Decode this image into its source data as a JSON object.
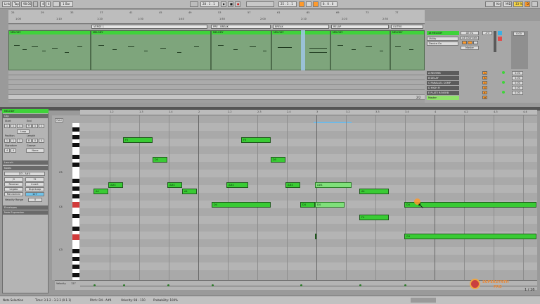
{
  "transport": {
    "link": "Link",
    "tap": "Tap",
    "tempo": "98.00",
    "sig_num": "4",
    "sig_den": "4",
    "quant": "1 Bar",
    "position": "28 . 1 . 1",
    "loop_start": "25 . 1 . 1",
    "loop_len": "8 . 0 . 0",
    "key": "Key",
    "midi": "MIDI",
    "cpu": "33 %",
    "d": "D"
  },
  "arrangement": {
    "bar_ticks": [
      "25",
      "29",
      "33",
      "37",
      "41",
      "45",
      "49",
      "53",
      "57",
      "61",
      "65",
      "69",
      "73",
      "77"
    ],
    "time_ticks": [
      "1:00",
      "1:10",
      "1:20",
      "1:30",
      "1:40",
      "1:50",
      "2:00",
      "2:10",
      "2:20",
      "2:30"
    ],
    "locators": [
      "VERSE 1",
      "PRE - BREAK",
      "BREAK",
      "RELAP",
      "OUTRO"
    ],
    "clips": [
      "MELODY",
      "MELODY",
      "MELODY",
      "MELODY",
      "MELODY",
      "MELODY"
    ],
    "counter": "2/2"
  },
  "mixer": {
    "main_track": "18 MELODY",
    "input_type": "All Ins",
    "input_channel": "All Channels",
    "monitor_label": "Utility",
    "routing": "Device On",
    "output": "Master",
    "volume": "-inf",
    "returns": [
      "A REVERB",
      "B DELAY",
      "C PARALLEL COMP",
      "D HIGH FI",
      "E PLATE REVERB",
      "Master"
    ],
    "return_letters": [
      "A",
      "B",
      "C",
      "D",
      "E",
      "M"
    ],
    "return_vals": [
      "0.00",
      "0.00",
      "0.00",
      "0.00",
      "0.00",
      "0.00"
    ]
  },
  "clip_view": {
    "title": "MELODY",
    "clip_header": "Clip",
    "start_label": "Start",
    "end_label": "End",
    "start_val": [
      "1",
      "1",
      "1"
    ],
    "end_val": [
      "9",
      "1",
      "1"
    ],
    "loop_label": "Loop",
    "position_label": "Position",
    "length_label": "Length",
    "position_val": [
      "1",
      "1",
      "1"
    ],
    "length_val": [
      "8",
      "0",
      "0"
    ],
    "signature_label": "Signature",
    "groove_label": "Groove",
    "sig_val": [
      "4",
      "4"
    ],
    "groove_val": "None",
    "launch_label": "Launch",
    "notes_label": "Notes",
    "note_range": "D3 - A#4",
    "btn_half": "/2",
    "btn_double": "*2",
    "btn_reverse": "Reverse",
    "btn_invert": "Invert",
    "btn_legato": "Legato",
    "btn_dupl": "Dupl.Loop",
    "randomize_label": "Randomize",
    "randomize_val": "127",
    "velocity_range_label": "Velocity Range",
    "velocity_range_val": "0",
    "envelopes_label": "Envelopes",
    "note_expression_label": "Note Expression"
  },
  "piano_roll": {
    "fold": "Fold",
    "ruler_ticks": [
      "1.2",
      "1.3",
      "1.4",
      "2",
      "2.2",
      "2.3",
      "2.4",
      "3",
      "3.2",
      "3.3",
      "3.4",
      "4",
      "4.2",
      "4.3",
      "4.4"
    ],
    "octave_labels": [
      "C5",
      "C4",
      "C3"
    ],
    "notes": [
      "F5",
      "F5",
      "D5",
      "D5",
      "A#4",
      "A#4",
      "A#4",
      "A#4",
      "A#4",
      "A4",
      "A4",
      "A4",
      "D4",
      "D4",
      "D4",
      "D4",
      "F4",
      "G4",
      "G4"
    ],
    "velocity_label": "Velocity",
    "velocity_val": "127"
  },
  "status": {
    "text": "Note Selection",
    "time": "Time: 3.1.2 - 3.2.3 (0.1.1)",
    "pitch": "Pitch: D4 - A#4",
    "velocity": "Velocity: 98 - 110",
    "probability": "Probability: 100%",
    "page": "1 / 16"
  },
  "watermark": {
    "brand": "SUPERSYNTH",
    "sub": "PRO"
  },
  "colors": {
    "note": "#39cb34",
    "clip_header": "#3fd33a",
    "accent": "#ff9a2b",
    "yellow": "#f5d54a",
    "selection": "#9fc6e6"
  }
}
